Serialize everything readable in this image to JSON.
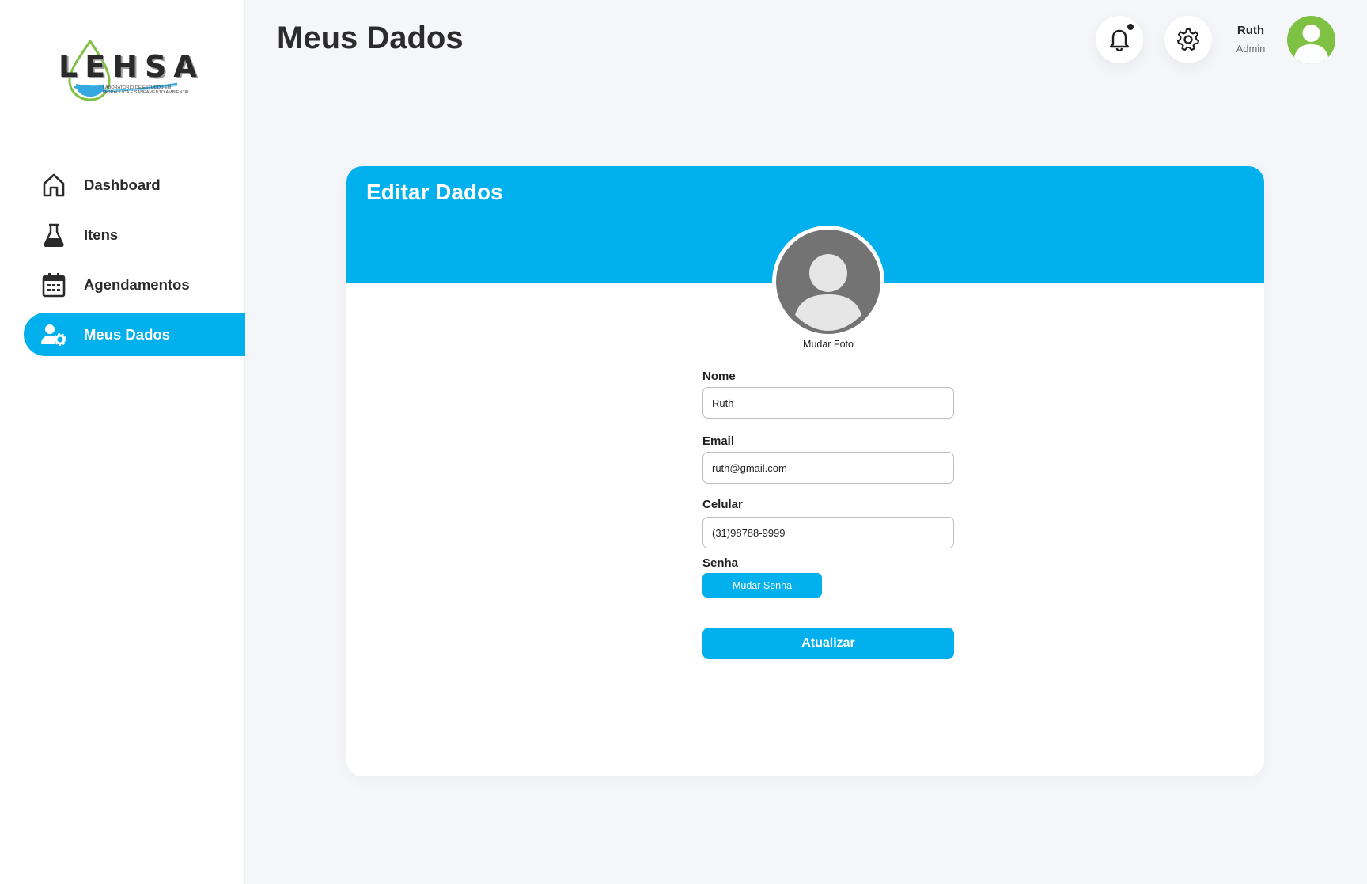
{
  "brand": {
    "logo_text": "LEHSA",
    "logo_subtitle": "Laboratório de Estudos em Hidráulica e Saneamento Ambiental"
  },
  "sidebar": {
    "items": [
      {
        "label": "Dashboard",
        "icon": "home-icon",
        "active": false
      },
      {
        "label": "Itens",
        "icon": "flask-icon",
        "active": false
      },
      {
        "label": "Agendamentos",
        "icon": "calendar-icon",
        "active": false
      },
      {
        "label": "Meus Dados",
        "icon": "user-gear-icon",
        "active": true
      }
    ]
  },
  "header": {
    "title": "Meus Dados",
    "notifications_icon": "bell-icon",
    "settings_icon": "gear-icon",
    "user": {
      "name": "Ruth",
      "role": "Admin"
    }
  },
  "card": {
    "title": "Editar Dados",
    "change_photo_label": "Mudar Foto",
    "fields": {
      "name": {
        "label": "Nome",
        "value": "Ruth"
      },
      "email": {
        "label": "Email",
        "value": "ruth@gmail.com"
      },
      "phone": {
        "label": "Celular",
        "value": "(31)98788-9999"
      },
      "password": {
        "label": "Senha",
        "button_label": "Mudar Senha"
      }
    },
    "submit_label": "Atualizar"
  },
  "colors": {
    "accent": "#03b0ee",
    "avatar": "#7ec143",
    "profile_placeholder": "#737373",
    "background": "#f5f6fa"
  }
}
